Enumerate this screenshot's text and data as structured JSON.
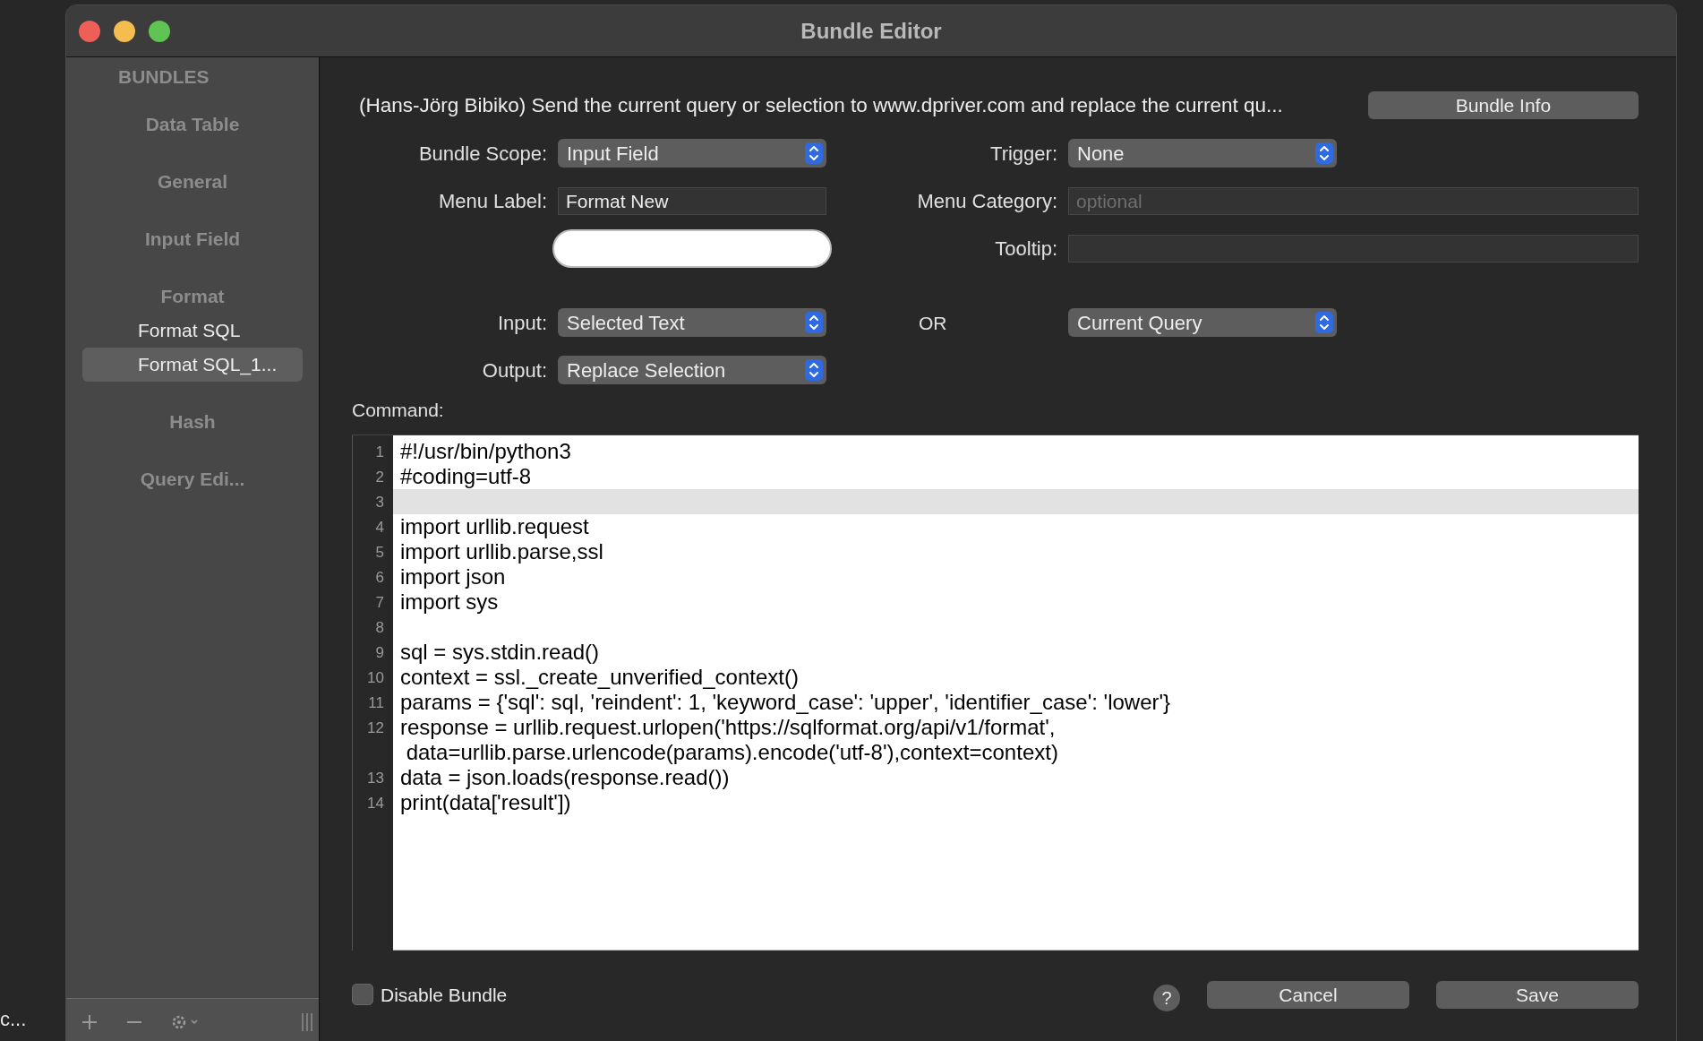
{
  "background": {
    "text": "c..."
  },
  "window": {
    "title": "Bundle Editor"
  },
  "sidebar": {
    "heading": "BUNDLES",
    "items": [
      {
        "label": "Data Table",
        "selected": false
      },
      {
        "label": "General",
        "selected": false
      },
      {
        "label": "Input Field",
        "selected": false
      },
      {
        "label": "Format",
        "selected": false,
        "children": [
          {
            "label": "Format SQL",
            "selected": false
          },
          {
            "label": "Format SQL_1...",
            "selected": true
          }
        ]
      },
      {
        "label": "Hash",
        "selected": false
      },
      {
        "label": "Query Edi...",
        "selected": false
      }
    ]
  },
  "description": "(Hans-Jörg Bibiko) Send the current query or selection to www.dpriver.com and replace the current qu...",
  "bundle_info_button": "Bundle Info",
  "bundle_scope": {
    "label": "Bundle Scope:",
    "value": "Input Field"
  },
  "trigger": {
    "label": "Trigger:",
    "value": "None"
  },
  "menu_label": {
    "label": "Menu Label:",
    "value": "Format New"
  },
  "menu_category": {
    "label": "Menu Category:",
    "placeholder": "optional"
  },
  "tooltip": {
    "label": "Tooltip:"
  },
  "input": {
    "label": "Input:",
    "value": "Selected Text"
  },
  "or": {
    "label": "OR",
    "value": "Current Query"
  },
  "output": {
    "label": "Output:",
    "value": "Replace Selection"
  },
  "command": {
    "label": "Command:",
    "lines": [
      {
        "number": "1",
        "text": "#!/usr/bin/python3",
        "current": false
      },
      {
        "number": "2",
        "text": "#coding=utf-8",
        "current": false
      },
      {
        "number": "3",
        "current": true
      },
      {
        "number": "4",
        "text": "import urllib.request",
        "current": false
      },
      {
        "number": "5",
        "text": "import urllib.parse,ssl",
        "current": false
      },
      {
        "number": "6",
        "text": "import json",
        "current": false
      },
      {
        "number": "7",
        "text": "import sys",
        "current": false
      },
      {
        "number": "8",
        "current": false
      },
      {
        "number": "9",
        "text": "sql = sys.stdin.read()",
        "current": false
      },
      {
        "number": "10",
        "text": "context = ssl._create_unverified_context()",
        "current": false
      },
      {
        "number": "11",
        "text": "params = {'sql': sql, 'reindent': 1, 'keyword_case': 'upper', 'identifier_case': 'lower'}",
        "current": false
      },
      {
        "number": "12",
        "text": "response = urllib.request.urlopen('https://sqlformat.org/api/v1/format',",
        "current": false
      },
      {
        "text": " data=urllib.parse.urlencode(params).encode('utf-8'),context=context)",
        "current": false
      },
      {
        "number": "13",
        "text": "data = json.loads(response.read())",
        "current": false
      },
      {
        "number": "14",
        "text": "print(data['result'])",
        "current": false
      }
    ]
  },
  "disable_bundle": {
    "label": "Disable Bundle",
    "checked": false
  },
  "help_button": "?",
  "buttons": [
    "Cancel",
    "Save"
  ]
}
